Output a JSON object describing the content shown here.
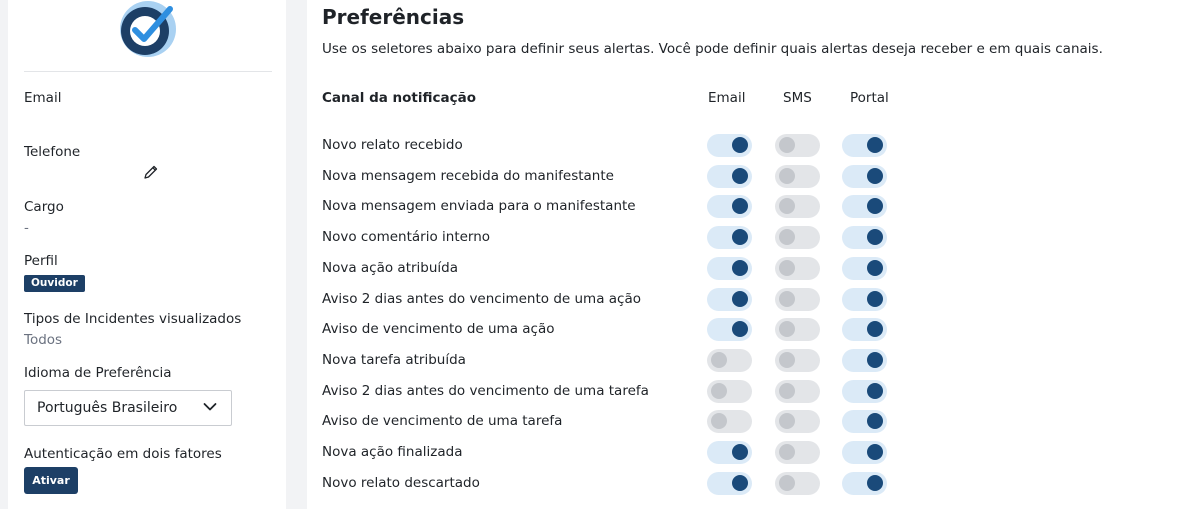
{
  "colors": {
    "brand": "#1d3f66",
    "toggle_on_knob": "#1a4a7a",
    "toggle_on_track": "#dbeaf7",
    "toggle_off": "#e3e5e8"
  },
  "sidebar": {
    "email_label": "Email",
    "telefone_label": "Telefone",
    "cargo_label": "Cargo",
    "cargo_value": "-",
    "perfil_label": "Perfil",
    "perfil_badge": "Ouvidor",
    "tipos_label": "Tipos de Incidentes visualizados",
    "tipos_value": "Todos",
    "idioma_label": "Idioma de Preferência",
    "idioma_value": "Português Brasileiro",
    "auth_label": "Autenticação em dois fatores",
    "auth_button": "Ativar"
  },
  "main": {
    "title": "Preferências",
    "description": "Use os seletores abaixo para definir seus alertas. Você pode definir quais alertas deseja receber e em quais canais.",
    "columns": [
      "Canal da notificação",
      "Email",
      "SMS",
      "Portal"
    ],
    "rows": [
      {
        "label": "Novo relato recebido",
        "email": true,
        "sms": false,
        "portal": true
      },
      {
        "label": "Nova mensagem recebida do manifestante",
        "email": true,
        "sms": false,
        "portal": true
      },
      {
        "label": "Nova mensagem enviada para o manifestante",
        "email": true,
        "sms": false,
        "portal": true
      },
      {
        "label": "Novo comentário interno",
        "email": true,
        "sms": false,
        "portal": true
      },
      {
        "label": "Nova ação atribuída",
        "email": true,
        "sms": false,
        "portal": true
      },
      {
        "label": "Aviso 2 dias antes do vencimento de uma ação",
        "email": true,
        "sms": false,
        "portal": true
      },
      {
        "label": "Aviso de vencimento de uma ação",
        "email": true,
        "sms": false,
        "portal": true
      },
      {
        "label": "Nova tarefa atribuída",
        "email": false,
        "sms": false,
        "portal": true
      },
      {
        "label": "Aviso 2 dias antes do vencimento de uma tarefa",
        "email": false,
        "sms": false,
        "portal": true
      },
      {
        "label": "Aviso de vencimento de uma tarefa",
        "email": false,
        "sms": false,
        "portal": true
      },
      {
        "label": "Nova ação finalizada",
        "email": true,
        "sms": false,
        "portal": true
      },
      {
        "label": "Novo relato descartado",
        "email": true,
        "sms": false,
        "portal": true
      }
    ]
  }
}
